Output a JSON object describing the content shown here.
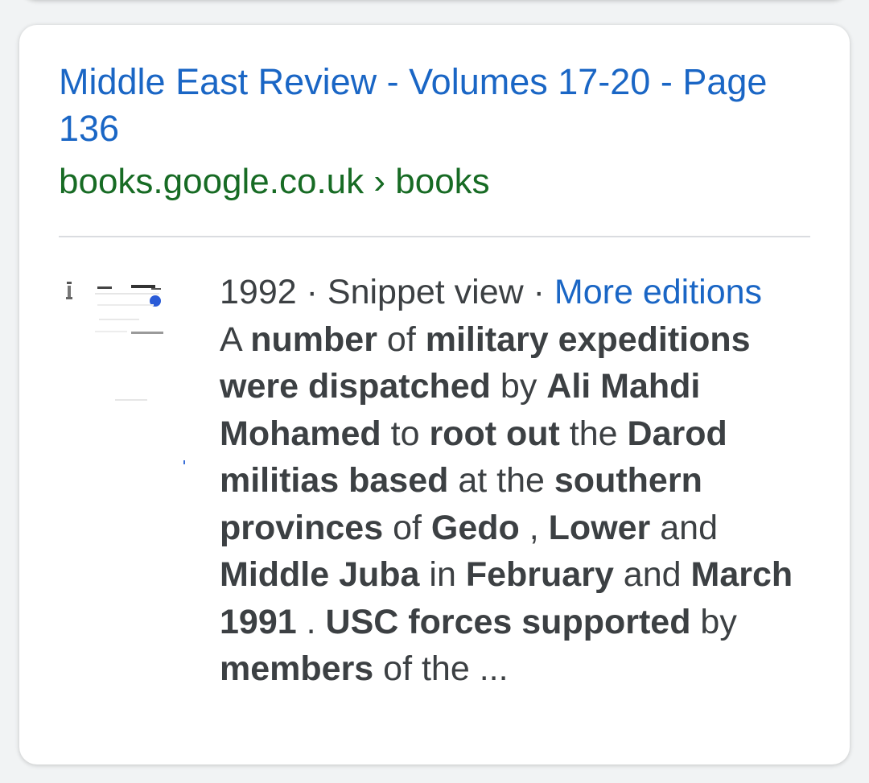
{
  "result": {
    "title": "Middle East Review - Volumes 17-20 - Page 136",
    "breadcrumb": "books.google.co.uk › books",
    "meta_year": "1992",
    "meta_sep1": " · ",
    "meta_view": "Snippet view",
    "meta_sep2": " · ",
    "more_editions": "More editions",
    "snippet_parts": [
      {
        "t": "A ",
        "b": false
      },
      {
        "t": "number",
        "b": true
      },
      {
        "t": " of ",
        "b": false
      },
      {
        "t": "military expeditions were dispatched",
        "b": true
      },
      {
        "t": " by ",
        "b": false
      },
      {
        "t": "Ali Mahdi Mohamed",
        "b": true
      },
      {
        "t": " to ",
        "b": false
      },
      {
        "t": "root out",
        "b": true
      },
      {
        "t": " the ",
        "b": false
      },
      {
        "t": "Darod militias based",
        "b": true
      },
      {
        "t": " at the ",
        "b": false
      },
      {
        "t": "southern provinces",
        "b": true
      },
      {
        "t": " of ",
        "b": false
      },
      {
        "t": "Gedo",
        "b": true
      },
      {
        "t": " , ",
        "b": false
      },
      {
        "t": "Lower",
        "b": true
      },
      {
        "t": " and ",
        "b": false
      },
      {
        "t": "Middle Juba",
        "b": true
      },
      {
        "t": " in ",
        "b": false
      },
      {
        "t": "February",
        "b": true
      },
      {
        "t": " and ",
        "b": false
      },
      {
        "t": "March 1991",
        "b": true
      },
      {
        "t": " . ",
        "b": false
      },
      {
        "t": "USC forces supported",
        "b": true
      },
      {
        "t": " by ",
        "b": false
      },
      {
        "t": "members",
        "b": true
      },
      {
        "t": " of the ...",
        "b": false
      }
    ]
  },
  "colors": {
    "link": "#1a66c5",
    "url_green": "#176b24",
    "text": "#3c4043"
  },
  "icons": {
    "thumbnail": "book-cover-thumbnail"
  }
}
